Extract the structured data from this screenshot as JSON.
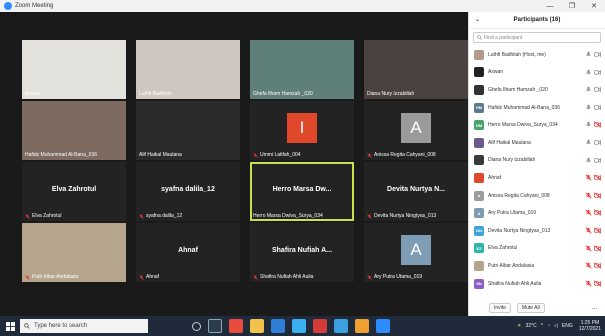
{
  "window": {
    "title": "Zoom Meeting",
    "min_glyph": "—",
    "max_glyph": "❐",
    "close_glyph": "✕"
  },
  "tiles": [
    {
      "id": "aswan",
      "label": "Aswan",
      "kind": "video",
      "muted": false,
      "bg": "#e4e2dc"
    },
    {
      "id": "luthfi",
      "label": "Luthfi Badhilah",
      "kind": "video",
      "muted": false,
      "bg": "#cfc6bf"
    },
    {
      "id": "ghefa",
      "label": "Ghefa Ilham Hamzah _020",
      "kind": "video",
      "muted": false,
      "bg": "#5f7f7a"
    },
    {
      "id": "diana",
      "label": "Diana Nury Izzabillah",
      "kind": "video",
      "muted": false,
      "bg": "#4a4240"
    },
    {
      "id": "hafidz",
      "label": "Hafidz Muhammad Al-Bana_036",
      "kind": "video",
      "muted": false,
      "bg": "#7c6a5f"
    },
    {
      "id": "alif",
      "label": "Alif Haikal Maulana",
      "kind": "video",
      "muted": false,
      "bg": "#2b2b2b"
    },
    {
      "id": "ummi",
      "label": "Ummi Latifah_004",
      "kind": "avatar",
      "letter": "I",
      "color": "#e0472b",
      "muted": true
    },
    {
      "id": "anissa",
      "label": "Anissa Regita Cahyani_008",
      "kind": "avatar",
      "letter": "A",
      "color": "#9b9b9b",
      "muted": true
    },
    {
      "id": "elva",
      "label": "Elva Zahrotul",
      "kind": "name",
      "big": "Elva Zahrotul",
      "muted": true
    },
    {
      "id": "syafna",
      "label": "syafna dalila_12",
      "kind": "name",
      "big": "syafna dalila_12",
      "muted": true
    },
    {
      "id": "herro",
      "label": "Herro Marsa Dwiva_Surya_034",
      "kind": "name",
      "big": "Herro Marsa Dw...",
      "muted": false,
      "active": true
    },
    {
      "id": "devita",
      "label": "Devita Nurtya Ningtyas_013",
      "kind": "name",
      "big": "Devita Nurtya N...",
      "muted": true
    },
    {
      "id": "putri",
      "label": "Putri Albar Andalasia",
      "kind": "video",
      "muted": true,
      "bg": "#b5a58c"
    },
    {
      "id": "ahnaf",
      "label": "Ahnaf",
      "kind": "name",
      "big": "Ahnaf",
      "muted": true
    },
    {
      "id": "shafira",
      "label": "Shafira Nufiah Ahli Aulia",
      "kind": "name",
      "big": "Shafira Nufiah A...",
      "muted": true
    },
    {
      "id": "ary",
      "label": "Ary Putra Utama_019",
      "kind": "avatar",
      "letter": "A",
      "color": "#7e9db4",
      "muted": true
    }
  ],
  "panel": {
    "title": "Participants (16)",
    "search_placeholder": "Find a participant",
    "participants": [
      {
        "name": "Luthfi Badhilah (Host, me)",
        "av": "",
        "avcolor": "#b49a8a",
        "mic": "on",
        "cam": "on"
      },
      {
        "name": "Aswan",
        "av": "",
        "avcolor": "#222222",
        "mic": "on",
        "cam": "on"
      },
      {
        "name": "Ghefa Ilham Hamzah _020",
        "av": "",
        "avcolor": "#333333",
        "mic": "on",
        "cam": "on"
      },
      {
        "name": "Hafidz Muhammad Al-Bana_036",
        "av": "HM",
        "avcolor": "#5c7a8e",
        "mic": "on",
        "cam": "on"
      },
      {
        "name": "Herro Marsa Dwiva_Surya_034",
        "av": "HM",
        "avcolor": "#4aa36a",
        "mic": "on",
        "cam": "off"
      },
      {
        "name": "Alif Haikal Maulana",
        "av": "",
        "avcolor": "#6b5a8e",
        "mic": "on",
        "cam": "on"
      },
      {
        "name": "Diana Nury Izzabillah",
        "av": "",
        "avcolor": "#3a3a3a",
        "mic": "on",
        "cam": "on"
      },
      {
        "name": "Ahnaf",
        "av": "",
        "avcolor": "#e0472b",
        "mic": "off",
        "cam": "off"
      },
      {
        "name": "Anissa Regita Cahyani_008",
        "av": "A",
        "avcolor": "#9b9b9b",
        "mic": "off",
        "cam": "off"
      },
      {
        "name": "Ary Putra Utama_019",
        "av": "A",
        "avcolor": "#7e9db4",
        "mic": "off",
        "cam": "off"
      },
      {
        "name": "Devita Nurtya Ningtyas_013",
        "av": "DN",
        "avcolor": "#3fa3d6",
        "mic": "off",
        "cam": "off"
      },
      {
        "name": "Elva Zahrotul",
        "av": "EZ",
        "avcolor": "#2fb5a8",
        "mic": "off",
        "cam": "off"
      },
      {
        "name": "Putri Albar Andalasia",
        "av": "",
        "avcolor": "#b5a58c",
        "mic": "off",
        "cam": "off"
      },
      {
        "name": "Shafira Nufiah Ahli Aulia",
        "av": "SN",
        "avcolor": "#8e5fc2",
        "mic": "off",
        "cam": "off"
      }
    ],
    "invite_label": "Invite",
    "mute_all_label": "Mute All",
    "more_label": "..."
  },
  "taskbar": {
    "search_placeholder": "Type here to search",
    "temperature": "32°C",
    "lang": "ENG",
    "time": "1:25 PM",
    "date": "12/7/2021"
  },
  "colors": {
    "accent": "#2d8cff",
    "muted_red": "#e23a3a",
    "active_border": "#c8e04a"
  }
}
